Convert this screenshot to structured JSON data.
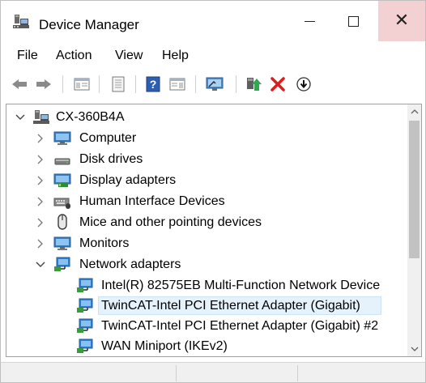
{
  "window": {
    "title": "Device Manager",
    "app_icon": "device-manager-icon",
    "controls": [
      "minimize-icon",
      "maximize-icon",
      "close-icon"
    ]
  },
  "menu": {
    "file": "File",
    "action": "Action",
    "view": "View",
    "help": "Help"
  },
  "toolbar": {
    "buttons": [
      "back-arrow-icon",
      "forward-arrow-icon",
      "show-hide-console-tree-icon",
      "properties-icon",
      "help-icon",
      "action-pane-icon",
      "scan-hardware-icon",
      "update-driver-icon",
      "uninstall-device-icon",
      "disable-device-icon"
    ]
  },
  "tree": {
    "root": {
      "label": "CX-360B4A",
      "expanded": true,
      "icon": "computer-root-icon"
    },
    "categories": [
      {
        "label": "Computer",
        "expanded": false,
        "icon": "monitor-icon"
      },
      {
        "label": "Disk drives",
        "expanded": false,
        "icon": "disk-drive-icon"
      },
      {
        "label": "Display adapters",
        "expanded": false,
        "icon": "display-adapter-icon"
      },
      {
        "label": "Human Interface Devices",
        "expanded": false,
        "icon": "hid-icon"
      },
      {
        "label": "Mice and other pointing devices",
        "expanded": false,
        "icon": "mouse-icon"
      },
      {
        "label": "Monitors",
        "expanded": false,
        "icon": "monitor-icon"
      },
      {
        "label": "Network adapters",
        "expanded": true,
        "icon": "network-adapter-icon"
      }
    ],
    "network_children": [
      {
        "label": "Intel(R) 82575EB Multi-Function Network Device",
        "selected": false
      },
      {
        "label": "TwinCAT-Intel PCI Ethernet Adapter (Gigabit)",
        "selected": true
      },
      {
        "label": "TwinCAT-Intel PCI Ethernet Adapter (Gigabit) #2",
        "selected": false
      },
      {
        "label": "WAN Miniport (IKEv2)",
        "selected": false
      }
    ]
  },
  "colors": {
    "selection_bg": "#e5f1fb",
    "close_hover": "#f3d1d3",
    "accent_blue": "#1e7bd6"
  }
}
